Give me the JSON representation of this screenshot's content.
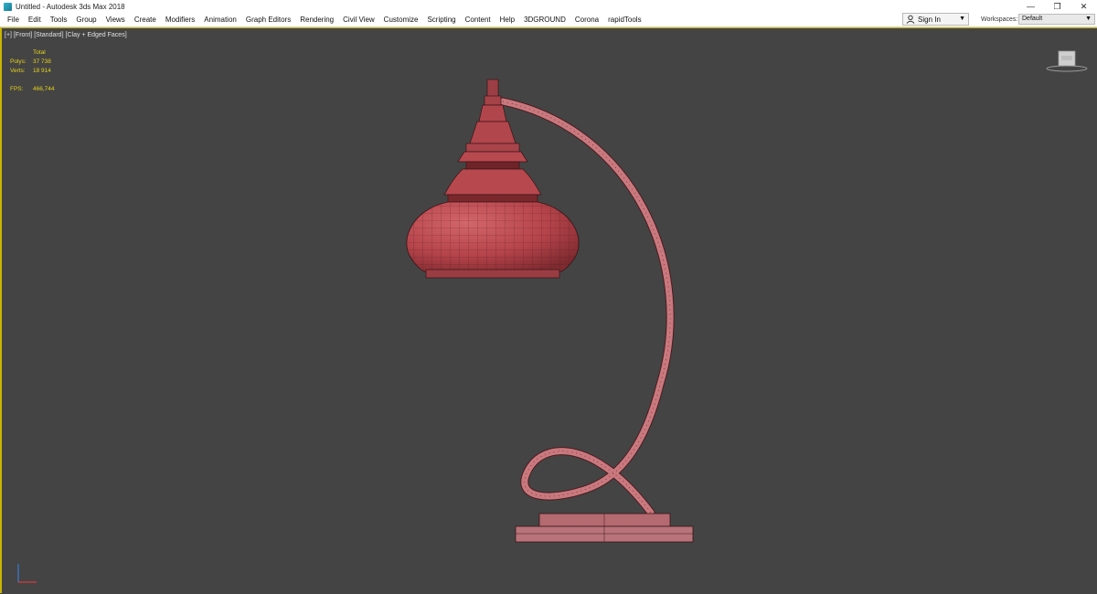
{
  "window": {
    "title": "Untitled - Autodesk 3ds Max 2018",
    "controls": {
      "minimize": "—",
      "restore": "❐",
      "close": "✕"
    }
  },
  "menu": {
    "items": [
      "File",
      "Edit",
      "Tools",
      "Group",
      "Views",
      "Create",
      "Modifiers",
      "Animation",
      "Graph Editors",
      "Rendering",
      "Civil View",
      "Customize",
      "Scripting",
      "Content",
      "Help",
      "3DGROUND",
      "Corona",
      "rapidTools"
    ]
  },
  "account": {
    "sign_in": "Sign In"
  },
  "workspace": {
    "label": "Workspaces:",
    "value": "Default"
  },
  "viewport": {
    "labels": [
      "[+]",
      "[Front]",
      "[Standard]",
      "[Clay + Edged Faces]"
    ],
    "stats": {
      "header": "Total",
      "polys_label": "Polys:",
      "polys_value": "37 738",
      "verts_label": "Verts:",
      "verts_value": "18 914",
      "fps_label": "FPS:",
      "fps_value": "466,744"
    },
    "border_color": "#c9b500",
    "background_color": "#444444",
    "model_color": "#b8474a"
  }
}
